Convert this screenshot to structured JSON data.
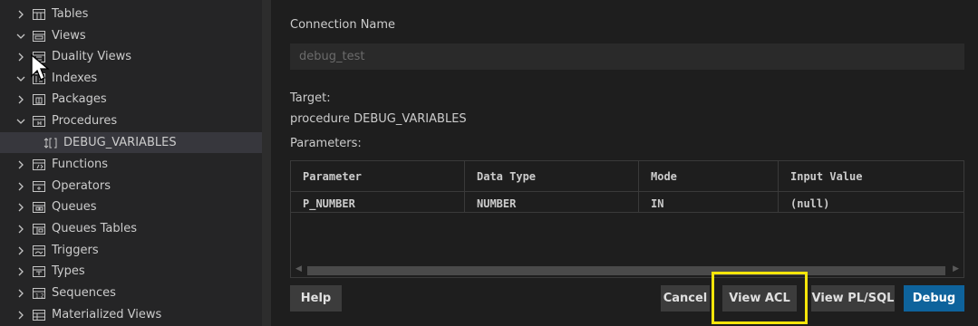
{
  "sidebar": {
    "items": [
      {
        "label": "Tables",
        "expanded": false,
        "icon": "table-icon"
      },
      {
        "label": "Views",
        "expanded": true,
        "icon": "view-icon"
      },
      {
        "label": "Duality Views",
        "expanded": false,
        "icon": "duality-view-icon"
      },
      {
        "label": "Indexes",
        "expanded": true,
        "icon": "index-icon"
      },
      {
        "label": "Packages",
        "expanded": false,
        "icon": "package-icon"
      },
      {
        "label": "Procedures",
        "expanded": true,
        "icon": "procedure-icon"
      },
      {
        "label": "DEBUG_VARIABLES",
        "selected": true,
        "icon": "debug-procedure-icon"
      },
      {
        "label": "Functions",
        "expanded": false,
        "icon": "function-icon"
      },
      {
        "label": "Operators",
        "expanded": false,
        "icon": "operator-icon"
      },
      {
        "label": "Queues",
        "expanded": false,
        "icon": "queue-icon"
      },
      {
        "label": "Queues Tables",
        "expanded": false,
        "icon": "queue-table-icon"
      },
      {
        "label": "Triggers",
        "expanded": false,
        "icon": "trigger-icon"
      },
      {
        "label": "Types",
        "expanded": false,
        "icon": "type-icon"
      },
      {
        "label": "Sequences",
        "expanded": false,
        "icon": "sequence-icon"
      },
      {
        "label": "Materialized Views",
        "expanded": false,
        "icon": "materialized-view-icon"
      }
    ]
  },
  "form": {
    "connection_name_label": "Connection Name",
    "connection_name_value": "debug_test",
    "target_label": "Target:",
    "target_value": "procedure DEBUG_VARIABLES",
    "parameters_label": "Parameters:"
  },
  "table": {
    "headers": [
      "Parameter",
      "Data Type",
      "Mode",
      "Input Value"
    ],
    "rows": [
      [
        "P_NUMBER",
        "NUMBER",
        "IN",
        "(null)"
      ]
    ]
  },
  "buttons": {
    "help": "Help",
    "cancel": "Cancel",
    "view_acl": "View ACL",
    "view_plsql": "View PL/SQL",
    "debug": "Debug"
  },
  "colors": {
    "accent": "#0e639c",
    "highlight": "#f5e50a"
  }
}
